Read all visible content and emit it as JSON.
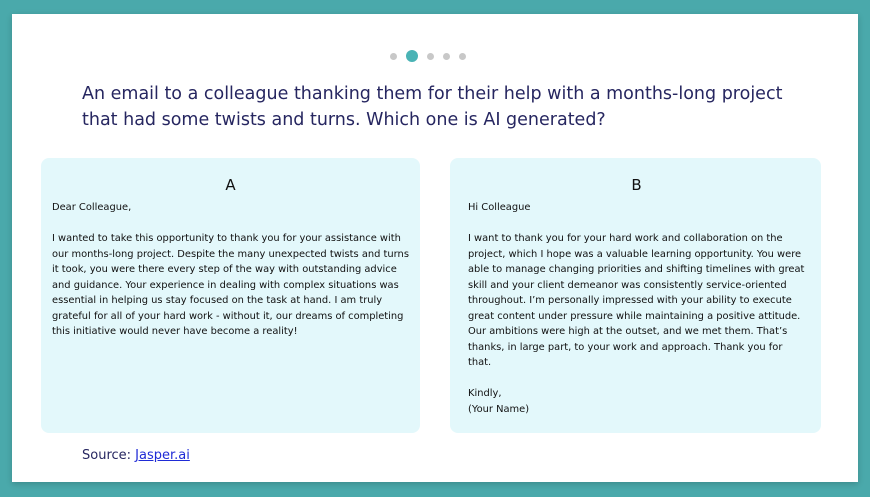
{
  "pager": {
    "count": 5,
    "active_index": 1,
    "active_color": "#4ab3b5",
    "inactive_color": "#c8c8c8"
  },
  "question": "An email to a colleague thanking them for their help with a months-long project that had some twists and turns. Which one is AI generated?",
  "options": [
    {
      "letter": "A",
      "paragraphs": [
        "Dear Colleague,",
        "I wanted to take this opportunity to thank you for your assistance with our months-long project. Despite the many unexpected twists and turns it took, you were there every step of the way with outstanding advice and guidance. Your experience in dealing with complex situations was essential in helping us stay focused on the task at hand. I am truly grateful for all of your hard work - without it, our dreams of completing this initiative would never have become a reality!"
      ]
    },
    {
      "letter": "B",
      "paragraphs": [
        "Hi Colleague",
        "I want to thank you for your hard work and collaboration on the project, which I hope was a valuable learning opportunity. You were able to manage changing priorities and shifting timelines with great skill and your client demeanor was consistently service-oriented throughout. I’m personally impressed with your ability to execute great content under pressure while maintaining a positive attitude. Our ambitions were high at the outset, and we met them. That’s thanks, in large part, to your work and approach. Thank you for that.",
        "Kindly,\n(Your Name)"
      ]
    }
  ],
  "source": {
    "label": "Source:",
    "link_text": "Jasper.ai"
  },
  "colors": {
    "background": "#4aa9ab",
    "card_background": "#e3f8fb",
    "question_text": "#262660",
    "link": "#1f2bd6"
  }
}
